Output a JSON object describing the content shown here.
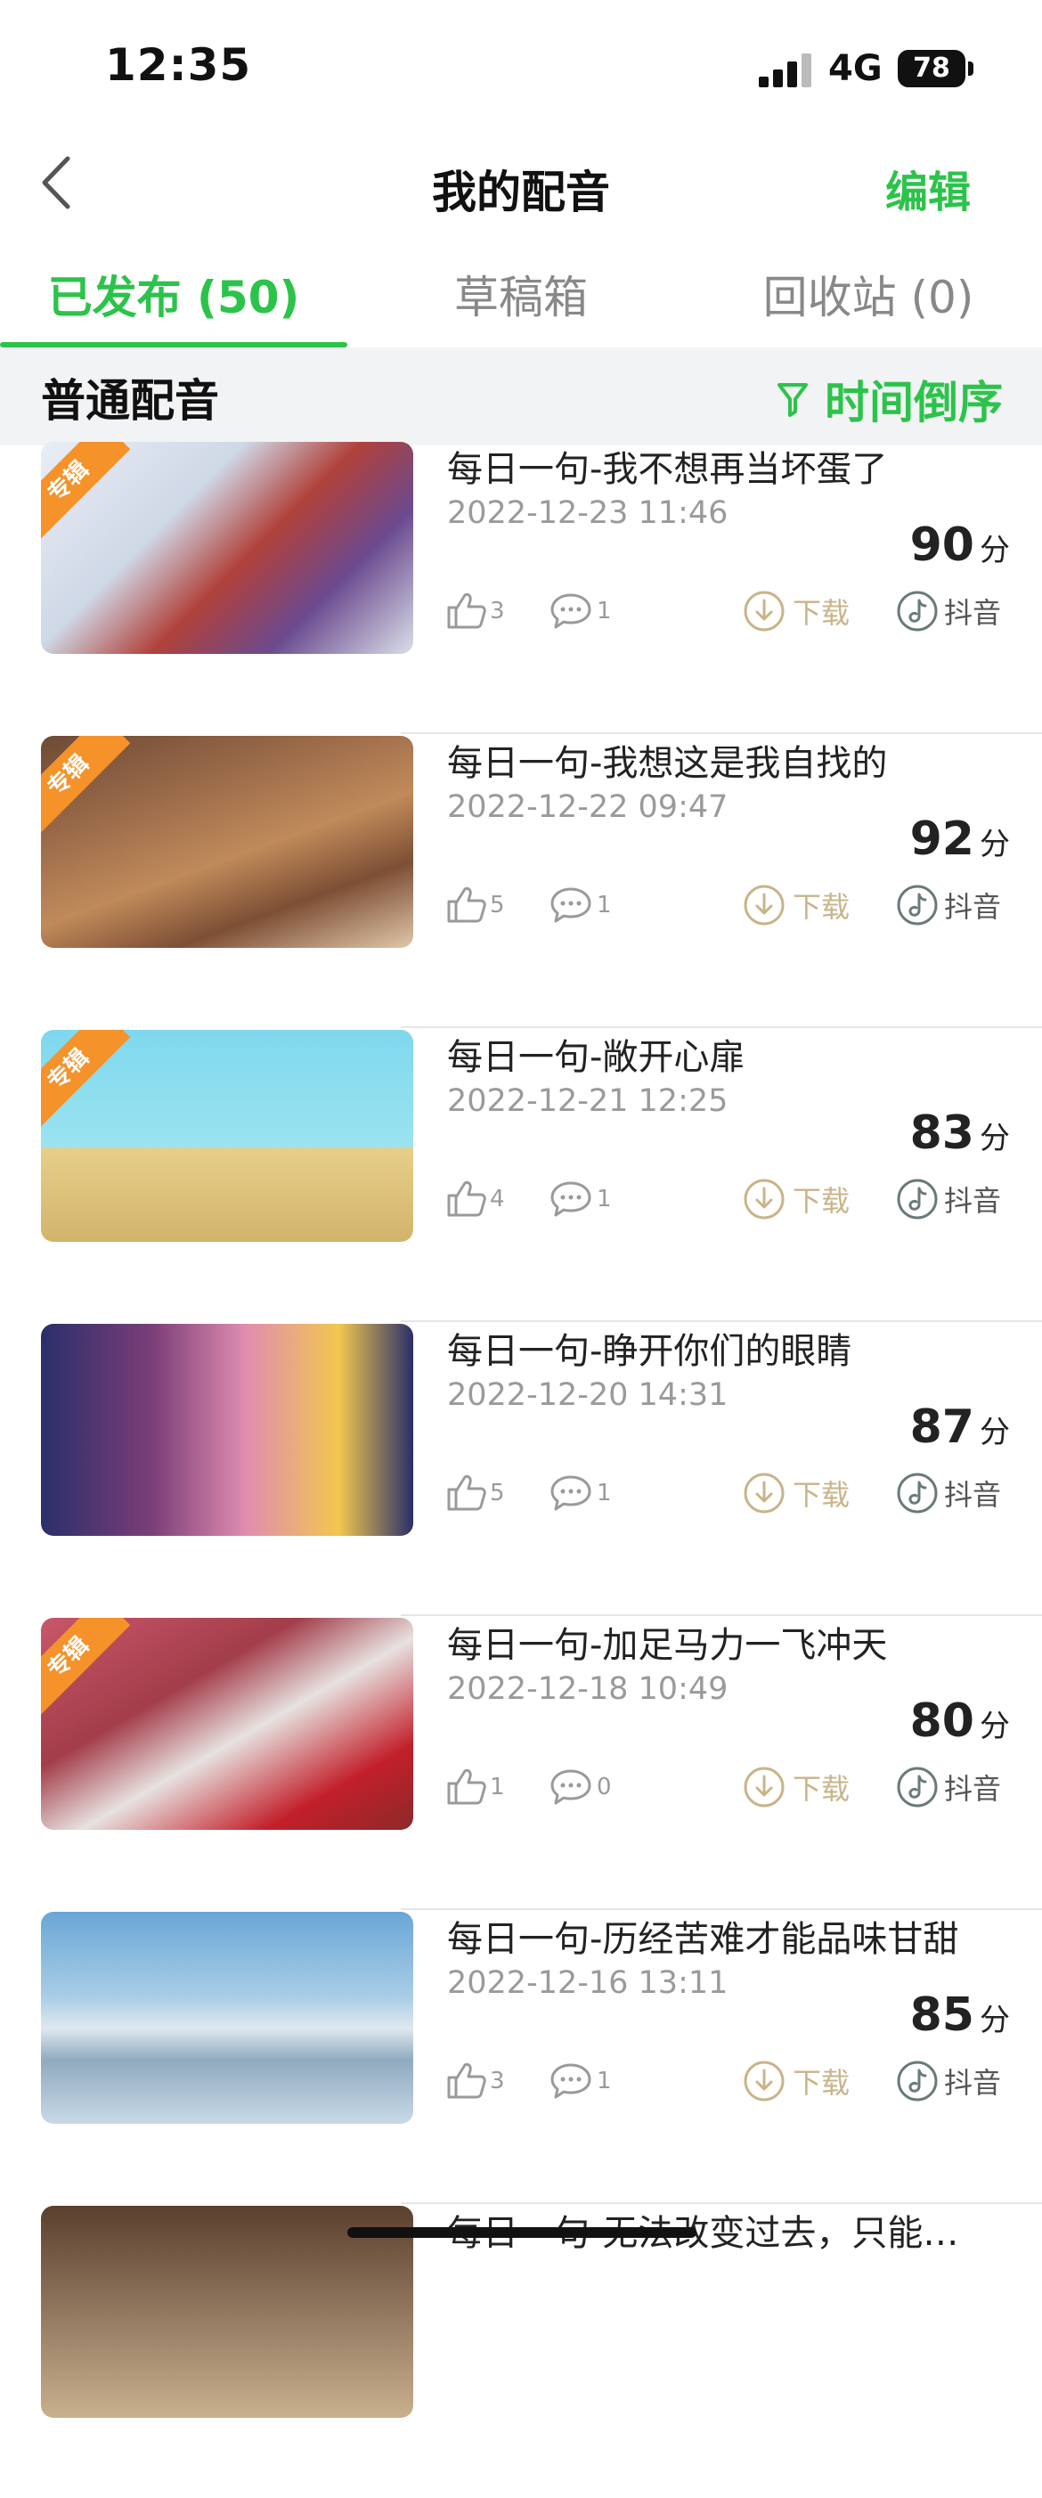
{
  "status_bar": {
    "time": "12:35",
    "network": "4G",
    "battery": "78"
  },
  "nav": {
    "title": "我的配音",
    "edit_label": "编辑"
  },
  "tabs": [
    {
      "label": "已发布 (50)",
      "active": true
    },
    {
      "label": "草稿箱",
      "active": false
    },
    {
      "label": "回收站 (0)",
      "active": false
    }
  ],
  "filter": {
    "category": "普通配音",
    "sort_label": "时间倒序"
  },
  "labels": {
    "download": "下载",
    "douyin": "抖音",
    "score_unit": "分",
    "album_badge": "专辑"
  },
  "items": [
    {
      "title": "每日一句-我不想再当坏蛋了",
      "date": "2022-12-23 11:46",
      "score": "90",
      "likes": "3",
      "comments": "1",
      "album": true
    },
    {
      "title": "每日一句-我想这是我自找的",
      "date": "2022-12-22 09:47",
      "score": "92",
      "likes": "5",
      "comments": "1",
      "album": true
    },
    {
      "title": "每日一句-敞开心扉",
      "date": "2022-12-21 12:25",
      "score": "83",
      "likes": "4",
      "comments": "1",
      "album": true
    },
    {
      "title": "每日一句-睁开你们的眼睛",
      "date": "2022-12-20 14:31",
      "score": "87",
      "likes": "5",
      "comments": "1",
      "album": false
    },
    {
      "title": "每日一句-加足马力一飞冲天",
      "date": "2022-12-18 10:49",
      "score": "80",
      "likes": "1",
      "comments": "0",
      "album": true
    },
    {
      "title": "每日一句-历经苦难才能品味甘甜",
      "date": "2022-12-16 13:11",
      "score": "85",
      "likes": "3",
      "comments": "1",
      "album": false
    },
    {
      "title": "每日一句-无法改变过去，只能…",
      "date": "",
      "score": "",
      "likes": "",
      "comments": "",
      "album": false
    }
  ]
}
